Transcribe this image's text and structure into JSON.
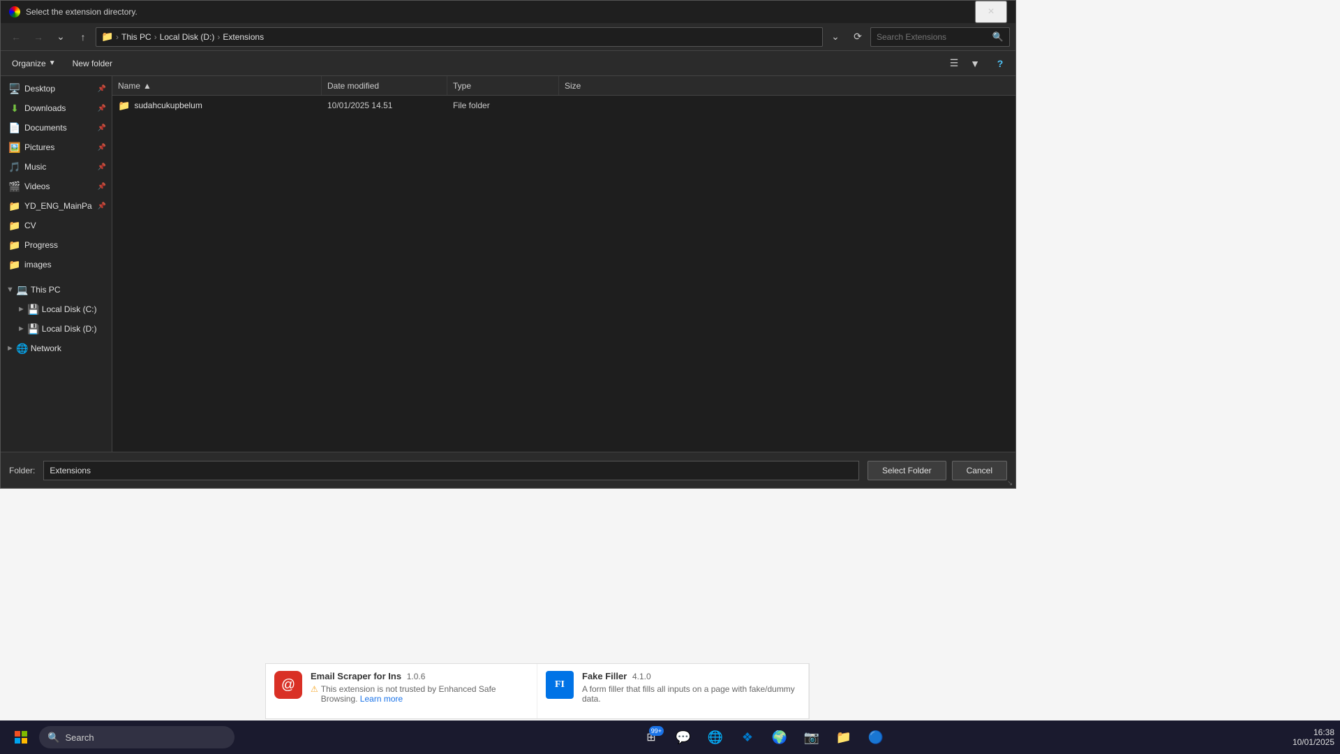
{
  "dialog": {
    "title": "Select the extension directory.",
    "close_label": "×",
    "nav": {
      "back_tooltip": "Back",
      "forward_tooltip": "Forward",
      "recent_tooltip": "Recent locations",
      "up_tooltip": "Up",
      "breadcrumb": [
        {
          "label": "📁",
          "is_icon": true
        },
        {
          "label": "This PC"
        },
        {
          "label": "Local Disk (D:)"
        },
        {
          "label": "Extensions"
        }
      ],
      "search_placeholder": "Search Extensions",
      "refresh_tooltip": "Refresh"
    },
    "toolbar": {
      "organize_label": "Organize",
      "new_folder_label": "New folder",
      "view_tooltip": "Change your view",
      "help_tooltip": "Get help"
    },
    "columns": {
      "name": "Name",
      "date_modified": "Date modified",
      "type": "Type",
      "size": "Size"
    },
    "files": [
      {
        "name": "sudahcukupbelum",
        "date_modified": "10/01/2025 14.51",
        "type": "File folder",
        "size": ""
      }
    ],
    "footer": {
      "folder_label": "Folder:",
      "folder_value": "Extensions",
      "select_button": "Select Folder",
      "cancel_button": "Cancel"
    }
  },
  "sidebar": {
    "pinned": [
      {
        "label": "Desktop",
        "icon": "folder-blue",
        "pinned": true
      },
      {
        "label": "Downloads",
        "icon": "download",
        "pinned": true
      },
      {
        "label": "Documents",
        "icon": "docs",
        "pinned": true
      },
      {
        "label": "Pictures",
        "icon": "pictures",
        "pinned": true
      },
      {
        "label": "Music",
        "icon": "music",
        "pinned": true
      },
      {
        "label": "Videos",
        "icon": "videos",
        "pinned": true
      },
      {
        "label": "YD_ENG_MainPa",
        "icon": "folder",
        "pinned": true
      },
      {
        "label": "CV",
        "icon": "folder",
        "pinned": false
      },
      {
        "label": "Progress",
        "icon": "folder",
        "pinned": false
      },
      {
        "label": "images",
        "icon": "folder",
        "pinned": false
      }
    ],
    "this_pc": {
      "label": "This PC",
      "expanded": true,
      "drives": [
        {
          "label": "Local Disk (C:)",
          "expanded": false
        },
        {
          "label": "Local Disk (D:)",
          "expanded": false
        }
      ]
    },
    "network": {
      "label": "Network",
      "expanded": false
    }
  },
  "extensions": {
    "email_scraper": {
      "name": "Email Scraper for Ins",
      "version": "1.0.6",
      "warning": "This extension is not trusted by Enhanced Safe Browsing.",
      "learn_more": "Learn more",
      "icon": "@"
    },
    "fake_filler": {
      "name": "Fake Filler",
      "version": "4.1.0",
      "description": "A form filler that fills all inputs on a page with fake/dummy data.",
      "icon": "FI"
    }
  },
  "taskbar": {
    "search_placeholder": "Search",
    "time": "16:38",
    "date": "10/01/2025",
    "icons": [
      {
        "name": "widgets",
        "symbol": "⊞",
        "badge": "99+"
      },
      {
        "name": "discord",
        "symbol": "💬",
        "badge": null
      },
      {
        "name": "chrome",
        "symbol": "🌐",
        "badge": null
      },
      {
        "name": "vscode",
        "symbol": "📝",
        "badge": null
      },
      {
        "name": "chrome-alt",
        "symbol": "🌍",
        "badge": null
      },
      {
        "name": "screen-capture",
        "symbol": "📷",
        "badge": null
      },
      {
        "name": "file-explorer",
        "symbol": "📁",
        "badge": null
      },
      {
        "name": "app",
        "symbol": "🔵",
        "badge": null
      }
    ]
  }
}
